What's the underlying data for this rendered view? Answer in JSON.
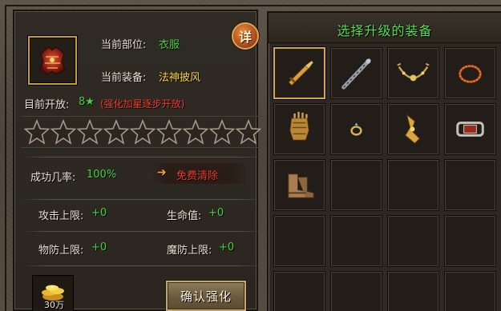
{
  "left": {
    "current_slot_label": "当前部位:",
    "current_slot_value": "衣服",
    "current_equip_label": "当前装备:",
    "current_equip_value": "法神披风",
    "open_label": "目前开放:",
    "open_value": "8★",
    "open_note": "(强化加星逐步开放)",
    "detail_button": "详",
    "stars_total": 9,
    "stars_filled": 0,
    "success_label": "成功几率:",
    "success_value": "100%",
    "free_clear_label": "免费清除",
    "stats": [
      {
        "label": "攻击上限:",
        "value": "+0"
      },
      {
        "label": "生命值:",
        "value": "+0"
      },
      {
        "label": "物防上限:",
        "value": "+0"
      },
      {
        "label": "魔防上限:",
        "value": "+0"
      }
    ],
    "cost_label": "30万",
    "confirm_button": "确认强化"
  },
  "right": {
    "title": "选择升级的装备",
    "slots": [
      {
        "icon": "sword-icon",
        "selected": true
      },
      {
        "icon": "staff-icon",
        "selected": false
      },
      {
        "icon": "necklace-icon",
        "selected": false
      },
      {
        "icon": "bracelet-icon",
        "selected": false
      },
      {
        "icon": "gauntlet-icon",
        "selected": false
      },
      {
        "icon": "ring-icon",
        "selected": false
      },
      {
        "icon": "belt-icon",
        "selected": false
      },
      {
        "icon": "chain-bracelet-icon",
        "selected": false
      },
      {
        "icon": "boots-icon",
        "selected": false
      },
      {
        "icon": "",
        "selected": false
      },
      {
        "icon": "",
        "selected": false
      },
      {
        "icon": "",
        "selected": false
      },
      {
        "icon": "",
        "selected": false
      },
      {
        "icon": "",
        "selected": false
      },
      {
        "icon": "",
        "selected": false
      },
      {
        "icon": "",
        "selected": false
      },
      {
        "icon": "",
        "selected": false
      },
      {
        "icon": "",
        "selected": false
      },
      {
        "icon": "",
        "selected": false
      },
      {
        "icon": "",
        "selected": false
      }
    ]
  },
  "colors": {
    "green": "#46d33c",
    "yellow": "#f2d13b",
    "red": "#f03a2c",
    "gold_border": "#c79e30"
  }
}
